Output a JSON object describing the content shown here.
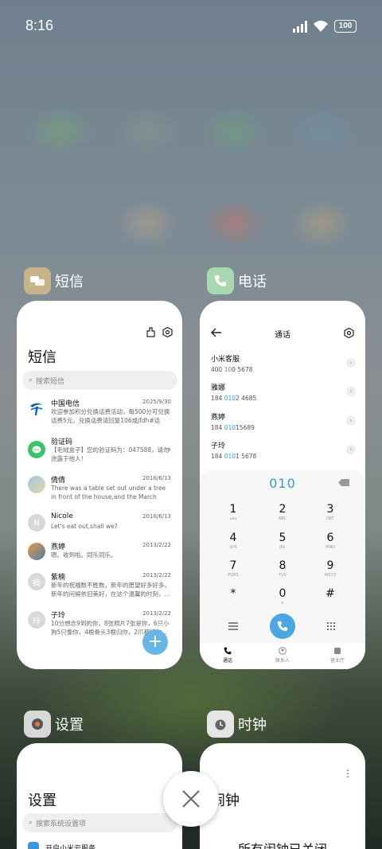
{
  "status_bar": {
    "time": "8:16",
    "battery": "100"
  },
  "apps": {
    "messages": {
      "name": "短信",
      "title": "短信",
      "search_placeholder": "搜索短信",
      "items": [
        {
          "name": "中国电信",
          "date": "2025/9/30",
          "preview": "欢迎参加积分兑换话费活动，每500分可兑换话费5元，兑换话费请回复106或jfdh#话费..."
        },
        {
          "name": "验证码",
          "date": "",
          "preview": "【毛绒盒子】您的验证码为：047588，请勿泄露于他人！"
        },
        {
          "name": "倩倩",
          "date": "2016/6/13",
          "preview": "There was a table set out under a tree in front of the house,and the March Hare an..."
        },
        {
          "name": "Nicole",
          "date": "2016/6/13",
          "preview": "Let's eat out,shall we?"
        },
        {
          "name": "燕婷",
          "date": "2013/2/22",
          "preview": "嗯。收到啦。同乐同乐。"
        },
        {
          "name": "紫楠",
          "date": "2013/2/22",
          "preview": "新年的祝福数不胜数，新年的愿望好多好多，新年的问候依旧美好，在这个温馨的时刻，..."
        },
        {
          "name": "子玲",
          "date": "2013/2/22",
          "preview": "10分想念9到的你，8张照片7张是你，6只小狗5只像你，4根骨头3根归你，2爪都给你..."
        }
      ],
      "avatar_letters": {
        "nicole": "N",
        "zinan": "楠",
        "ziling": "玲"
      }
    },
    "phone": {
      "name": "电话",
      "title": "通话",
      "contacts": [
        {
          "name": "小米客服",
          "num_a": "400 ",
          "num_hl": "10",
          "num_b": "0 5678"
        },
        {
          "name": "雅娜",
          "num_a": "184 ",
          "num_hl": "010",
          "num_b": "2 4685"
        },
        {
          "name": "燕婷",
          "num_a": "184 ",
          "num_hl": "010",
          "num_b": "15689"
        },
        {
          "name": "子玲",
          "num_a": "184 ",
          "num_hl": "010",
          "num_b": "1 5678"
        }
      ],
      "dialed": "010",
      "keys": [
        {
          "d": "1",
          "l": "ωω"
        },
        {
          "d": "2",
          "l": "ABC"
        },
        {
          "d": "3",
          "l": "DEF"
        },
        {
          "d": "4",
          "l": "GHI"
        },
        {
          "d": "5",
          "l": "JKL"
        },
        {
          "d": "6",
          "l": "MNO"
        },
        {
          "d": "7",
          "l": "PQRS"
        },
        {
          "d": "8",
          "l": "TUV"
        },
        {
          "d": "9",
          "l": "WXYZ"
        },
        {
          "d": "*",
          "l": ","
        },
        {
          "d": "0",
          "l": "+"
        },
        {
          "d": "#",
          "l": ""
        }
      ],
      "tabs": [
        "通话",
        "联系人",
        "营业厅"
      ]
    },
    "settings": {
      "name": "设置",
      "title": "设置",
      "search_placeholder": "搜索系统设置项",
      "first_item": "开启小米云服务"
    },
    "clock": {
      "name": "时钟",
      "title": "闹钟",
      "status": "所有闹钟已关闭"
    }
  },
  "colors": {
    "accent": "#3a97d8",
    "sms_icon_bg": "#c9b48a",
    "phone_icon_bg": "#a8d8b0"
  }
}
